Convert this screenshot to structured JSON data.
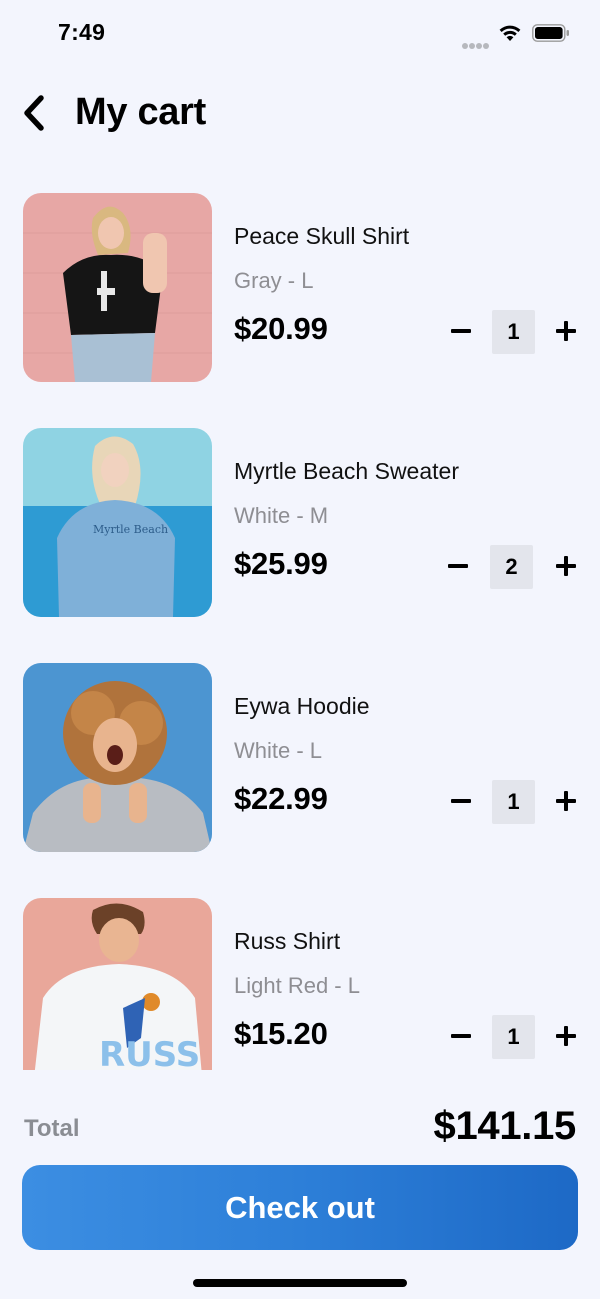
{
  "status_bar": {
    "time": "7:49"
  },
  "header": {
    "title": "My cart",
    "back_icon": "chevron-left-icon"
  },
  "cart": {
    "items": [
      {
        "name": "Peace Skull Shirt",
        "variant": "Gray - L",
        "price": "$20.99",
        "quantity": "1"
      },
      {
        "name": "Myrtle Beach Sweater",
        "variant": "White - M",
        "price": "$25.99",
        "quantity": "2"
      },
      {
        "name": "Eywa Hoodie",
        "variant": "White - L",
        "price": "$22.99",
        "quantity": "1"
      },
      {
        "name": "Russ Shirt",
        "variant": "Light Red - L",
        "price": "$15.20",
        "quantity": "1"
      }
    ]
  },
  "footer": {
    "total_label": "Total",
    "total_value": "$141.15",
    "checkout_label": "Check out"
  },
  "colors": {
    "background": "#f3f5fd",
    "accent": "#2d7fd8",
    "muted_text": "#8e8e93",
    "qty_box": "#e3e5ec"
  }
}
